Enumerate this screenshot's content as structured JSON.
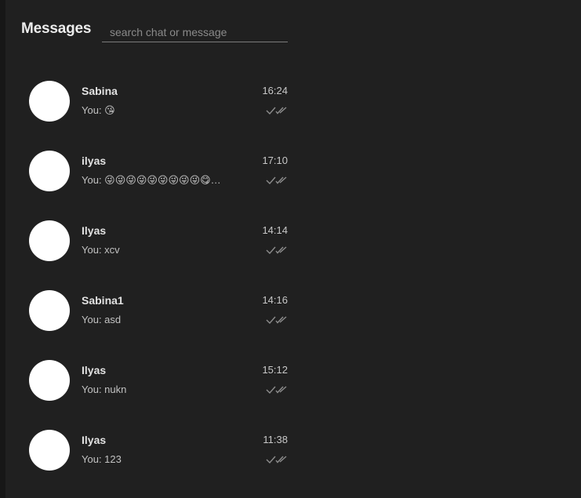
{
  "header": {
    "title": "Messages",
    "search_placeholder": "search chat or message"
  },
  "chats": [
    {
      "name": "Sabina",
      "time": "16:24",
      "message": "You: 😘",
      "status_icon": "double-check-icon"
    },
    {
      "name": "ilyas",
      "time": "17:10",
      "message": "You: 😜😜😜😜😜😜😜😜😜😋…",
      "status_icon": "double-check-icon"
    },
    {
      "name": "Ilyas",
      "time": "14:14",
      "message": "You: xcv",
      "status_icon": "double-check-icon"
    },
    {
      "name": "Sabina1",
      "time": "14:16",
      "message": "You: asd",
      "status_icon": "double-check-icon"
    },
    {
      "name": "Ilyas",
      "time": "15:12",
      "message": "You: nukn",
      "status_icon": "double-check-icon"
    },
    {
      "name": "Ilyas",
      "time": "11:38",
      "message": "You: 123",
      "status_icon": "double-check-icon"
    }
  ],
  "colors": {
    "background": "#171717",
    "panel": "#202020",
    "avatar": "#ffffff",
    "text": "#e2e2e2",
    "muted": "#8a8a8a"
  }
}
